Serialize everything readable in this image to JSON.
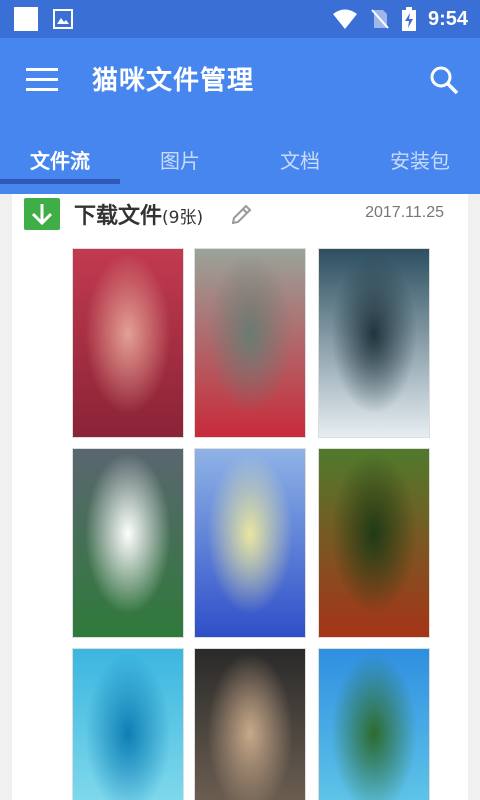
{
  "status_bar": {
    "time": "9:54",
    "icons": [
      "white-square-icon",
      "photo-icon",
      "wifi-icon",
      "no-sim-icon",
      "battery-charging-icon"
    ]
  },
  "app_bar": {
    "title": "猫咪文件管理",
    "menu_icon": "hamburger-menu-icon",
    "search_icon": "search-icon"
  },
  "tabs": [
    {
      "label": "文件流",
      "active": true
    },
    {
      "label": "图片",
      "active": false
    },
    {
      "label": "文档",
      "active": false
    },
    {
      "label": "安装包",
      "active": false
    }
  ],
  "folder": {
    "name": "下载文件",
    "count_label": "(9张)",
    "date": "2017.11.25",
    "icon": "download-arrow-icon",
    "edit_icon": "pencil-icon"
  },
  "thumbnails": [
    {
      "name": "thumb-autumn-path",
      "colors": [
        "#c23a4f",
        "#8a2336",
        "#e3a094"
      ]
    },
    {
      "name": "thumb-rose-hand",
      "colors": [
        "#9aa39a",
        "#c82a3a",
        "#6b7b72"
      ]
    },
    {
      "name": "thumb-waterfall",
      "colors": [
        "#2c4f60",
        "#e6eef2",
        "#20343d"
      ]
    },
    {
      "name": "thumb-water-lilies",
      "colors": [
        "#5a6670",
        "#2f7a3a",
        "#ffffff"
      ]
    },
    {
      "name": "thumb-blue-flowers",
      "colors": [
        "#8fb3e6",
        "#2f4fc9",
        "#e9e6a0"
      ]
    },
    {
      "name": "thumb-forest-path",
      "colors": [
        "#4f7a2c",
        "#a63418",
        "#1f3a14"
      ]
    },
    {
      "name": "thumb-pier-sea",
      "colors": [
        "#3bb6e0",
        "#8fe0ef",
        "#0e7fb5"
      ]
    },
    {
      "name": "thumb-girl-sitting",
      "colors": [
        "#2a2a2a",
        "#7a6a5a",
        "#c9a98a"
      ]
    },
    {
      "name": "thumb-beach-palms",
      "colors": [
        "#2f8fe0",
        "#6ad0ea",
        "#2d6b2f"
      ]
    }
  ]
}
